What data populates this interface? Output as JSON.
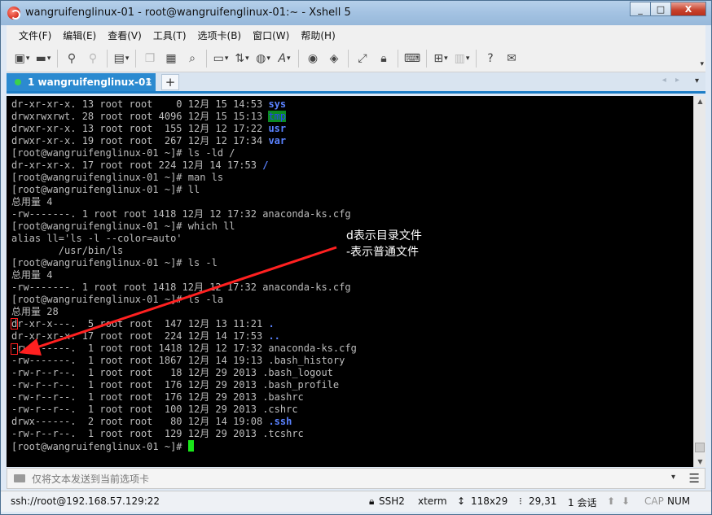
{
  "window": {
    "title": "wangruifenglinux-01 - root@wangruifenglinux-01:~ - Xshell 5",
    "min": "_",
    "max": "□",
    "close": "X"
  },
  "menu": [
    "文件(F)",
    "编辑(E)",
    "查看(V)",
    "工具(T)",
    "选项卡(B)",
    "窗口(W)",
    "帮助(H)"
  ],
  "toolbar": {
    "icons": [
      "new-session-icon",
      "open-folder-icon",
      "connect-icon",
      "disconnect-icon",
      "properties-icon",
      "copy-icon",
      "paste-icon",
      "find-icon",
      "print-icon",
      "transfer-icon",
      "globe-icon",
      "font-icon",
      "xftp-icon",
      "xagent-icon",
      "fullscreen-icon",
      "lock-icon",
      "keyboard-icon",
      "add-tab-icon",
      "layout-icon",
      "help-icon",
      "chat-icon"
    ],
    "more": "▾"
  },
  "tabs": {
    "active_label": "1 wangruifenglinux-01",
    "close": "×",
    "add": "+",
    "nav": "◂ ▸",
    "menu": "▾"
  },
  "terminal": {
    "lines": [
      "dr-xr-xr-x. 13 root root    0 12月 15 14:53 ",
      "drwxrwxrwt. 28 root root 4096 12月 15 15:13 ",
      "drwxr-xr-x. 13 root root  155 12月 12 17:22 ",
      "drwxr-xr-x. 19 root root  267 12月 12 17:34 ",
      "[root@wangruifenglinux-01 ~]# ls -ld /",
      "dr-xr-xr-x. 17 root root 224 12月 14 17:53 ",
      "[root@wangruifenglinux-01 ~]# man ls",
      "[root@wangruifenglinux-01 ~]# ll",
      "总用量 4",
      "-rw-------. 1 root root 1418 12月 12 17:32 anaconda-ks.cfg",
      "[root@wangruifenglinux-01 ~]# which ll",
      "alias ll='ls -l --color=auto'",
      "        /usr/bin/ls",
      "[root@wangruifenglinux-01 ~]# ls -l",
      "总用量 4",
      "-rw-------. 1 root root 1418 12月 12 17:32 anaconda-ks.cfg",
      "[root@wangruifenglinux-01 ~]# ls -la",
      "总用量 28",
      "dr-xr-x---.  5 root root  147 12月 13 11:21 ",
      "dr-xr-xr-x. 17 root root  224 12月 14 17:53 ",
      "-rw-------.  1 root root 1418 12月 12 17:32 anaconda-ks.cfg",
      "-rw-------.  1 root root 1867 12月 14 19:13 .bash_history",
      "-rw-r--r--.  1 root root   18 12月 29 2013 .bash_logout",
      "-rw-r--r--.  1 root root  176 12月 29 2013 .bash_profile",
      "-rw-r--r--.  1 root root  176 12月 29 2013 .bashrc",
      "-rw-r--r--.  1 root root  100 12月 29 2013 .cshrc",
      "drwx------.  2 root root   80 12月 14 19:08 ",
      "-rw-r--r--.  1 root root  129 12月 29 2013 .tcshrc",
      "[root@wangruifenglinux-01 ~]# "
    ],
    "highlights": {
      "sys": "sys",
      "tmp": "tmp",
      "usr": "usr",
      "var": "var",
      "root": "/",
      "dot": ".",
      "dotdot": "..",
      "ssh": ".ssh"
    }
  },
  "annotation": {
    "line1": "d表示目录文件",
    "line2": "-表示普通文件",
    "color": "#ff2020"
  },
  "sendbar": {
    "placeholder": "仅将文本发送到当前选项卡",
    "dropdown": "▾",
    "menu": "☰"
  },
  "status": {
    "connection": "ssh://root@192.168.57.129:22",
    "protocol": "SSH2",
    "term": "xterm",
    "size": "118x29",
    "cursor": "29,31",
    "sessions": "1 会话",
    "caps": "CAP",
    "num": "NUM"
  },
  "colors": {
    "tab_active": "#2b8ad0",
    "directory": "#5a82ff",
    "tmp_bg": "#0b8a23",
    "cursor": "#19e619"
  }
}
